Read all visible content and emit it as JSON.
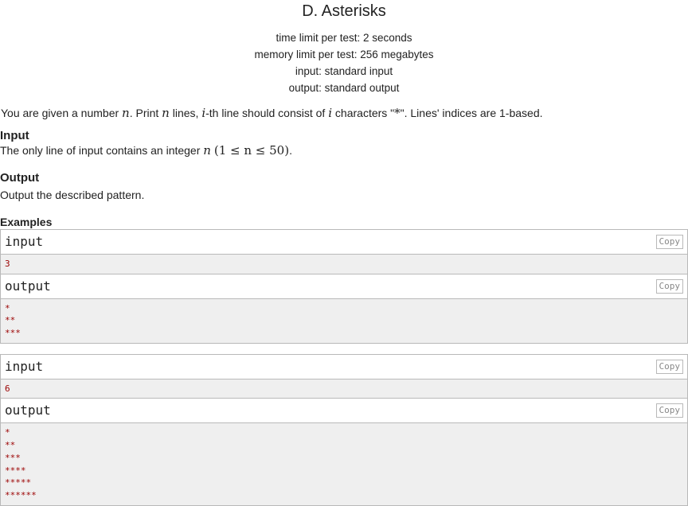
{
  "problem": {
    "title": "D. Asterisks",
    "time_limit": "time limit per test: 2 seconds",
    "memory_limit": "memory limit per test: 256 megabytes",
    "input_file": "input: standard input",
    "output_file": "output: standard output"
  },
  "legend": {
    "p1": "You are given a number ",
    "n": "n",
    "p2": ". Print ",
    "p3": " lines, ",
    "i": "i",
    "p4": "-th line should consist of ",
    "p5": " characters \"",
    "star": "*",
    "p6": "\". Lines' indices are 1-based."
  },
  "input_section": {
    "title": "Input",
    "text_before": "The only line of input contains an integer ",
    "math": "(1 ≤ n ≤ 50)",
    "text_after": "."
  },
  "output_section": {
    "title": "Output",
    "text": "Output the described pattern."
  },
  "examples": {
    "title": "Examples",
    "input_label": "input",
    "output_label": "output",
    "copy_label": "Copy",
    "list": [
      {
        "input": [
          "3"
        ],
        "output": [
          "*",
          "**",
          "***"
        ]
      },
      {
        "input": [
          "6"
        ],
        "output": [
          "*",
          "**",
          "***",
          "****",
          "*****",
          "******"
        ]
      }
    ]
  }
}
